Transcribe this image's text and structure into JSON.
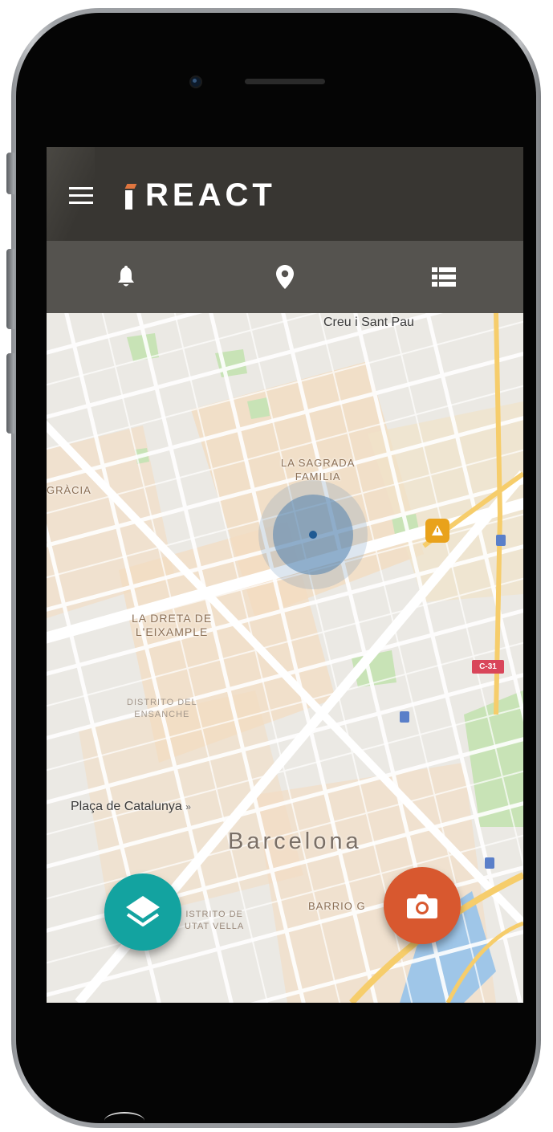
{
  "app": {
    "brand": "REACT",
    "colors": {
      "appbar": "#383632",
      "tabbar": "#55534f",
      "accent_orange": "#d8582f",
      "accent_teal": "#13a3a0",
      "location": "#1f5a93"
    }
  },
  "header": {
    "menu_icon": "hamburger-menu-icon"
  },
  "tabs": [
    {
      "icon": "bell-icon",
      "name": "notifications"
    },
    {
      "icon": "map-pin-icon",
      "name": "map"
    },
    {
      "icon": "list-icon",
      "name": "list"
    }
  ],
  "map": {
    "labels": {
      "hospital": "Creu i Sant Pau",
      "sagrada_line1": "LA SAGRADA",
      "sagrada_line2": "FAMILIA",
      "gracia": "GRÀCIA",
      "dreta_line1": "LA DRETA DE",
      "dreta_line2": "L'EIXAMPLE",
      "distrito_line1": "DISTRITO DEL",
      "distrito_line2": "ENSANCHE",
      "plaza": "Plaça de Catalunya",
      "plaza_arrow": "»",
      "city": "Barcelona",
      "barrio": "BARRIO G",
      "ciutat_line1": "ISTRITO DE",
      "ciutat_line2": "UTAT VELLA",
      "road_badge": "C-31"
    }
  },
  "actions": {
    "layers_icon": "layers-icon",
    "camera_icon": "camera-icon"
  }
}
